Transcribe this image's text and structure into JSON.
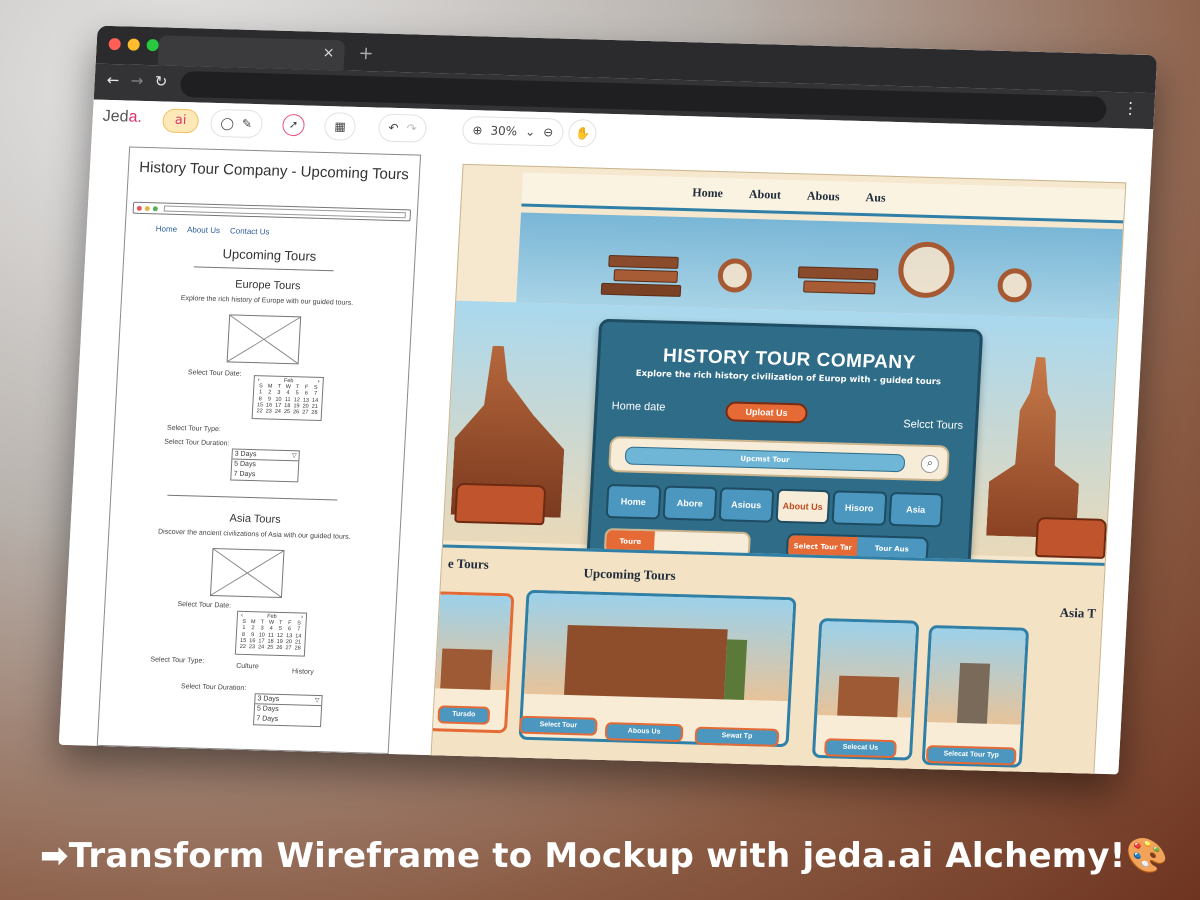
{
  "browser": {
    "tab_close": "×",
    "tab_new": "+",
    "back": "←",
    "forward": "→",
    "reload": "↻",
    "menu": "⋮",
    "traffic_colors": [
      "#ff5f57",
      "#febc2e",
      "#28c840"
    ]
  },
  "toolbar": {
    "logo_main": "Jed",
    "logo_accent": "a.",
    "ai_label": "ai",
    "zoom": "30%"
  },
  "wireframe": {
    "title": "History Tour Company - Upcoming Tours",
    "nav": [
      "Home",
      "About Us",
      "Contact Us"
    ],
    "section_heading": "Upcoming Tours",
    "europe": {
      "heading": "Europe Tours",
      "description": "Explore the rich history of Europe with our guided tours.",
      "date_label": "Select Tour Date:",
      "type_label": "Select Tour Type:",
      "duration_label": "Select Tour Duration:",
      "calendar_month": "Feb",
      "durations": [
        "3 Days",
        "5 Days",
        "7 Days"
      ]
    },
    "asia": {
      "heading": "Asia Tours",
      "description": "Discover the ancient civilizations of Asia with our guided tours.",
      "date_label": "Select Tour Date:",
      "type_label": "Select Tour Type:",
      "type_options": [
        "Culture",
        "History"
      ],
      "duration_label": "Select Tour Duration:",
      "calendar_month": "Feb",
      "durations": [
        "3 Days",
        "5 Days",
        "7 Days"
      ]
    },
    "calendar_days": [
      "S",
      "M",
      "T",
      "W",
      "T",
      "F",
      "S",
      "1",
      "2",
      "3",
      "4",
      "5",
      "6",
      "7",
      "8",
      "9",
      "10",
      "11",
      "12",
      "13",
      "14",
      "15",
      "16",
      "17",
      "18",
      "19",
      "20",
      "21",
      "22",
      "23",
      "24",
      "25",
      "26",
      "27",
      "28"
    ]
  },
  "mockup": {
    "nav": [
      "Home",
      "About",
      "Abous",
      "Aus"
    ],
    "title": "HISTORY TOUR COMPANY",
    "subtitle": "Explore the rich history civilization of Europ with - guided tours",
    "home_date": "Home date",
    "upload_button": "Uploat Us",
    "select_tours": "Selcct Tours",
    "search_placeholder": "Upcmst Tour",
    "tabs": [
      "Home",
      "Abore",
      "Asious",
      "About Us",
      "Hisoro",
      "Asia"
    ],
    "active_tab": "About Us",
    "field_button": "Toure",
    "split_left": "Select Tour Tar",
    "split_right": "Tour Aus",
    "section_left": "e Tours",
    "section_upcoming": "Upcoming Tours",
    "section_right": "Asia T",
    "card_buttons": [
      "Tursdo",
      "Select Tour",
      "Abous Us",
      "Sewat Tp",
      "Selecat Us",
      "Selecat Tour Typ"
    ],
    "colors": {
      "accent": "#e56a35",
      "blue": "#2e6c88",
      "cream": "#f5e8cf"
    }
  },
  "caption": "➡Transform Wireframe to Mockup with jeda.ai Alchemy!🎨"
}
